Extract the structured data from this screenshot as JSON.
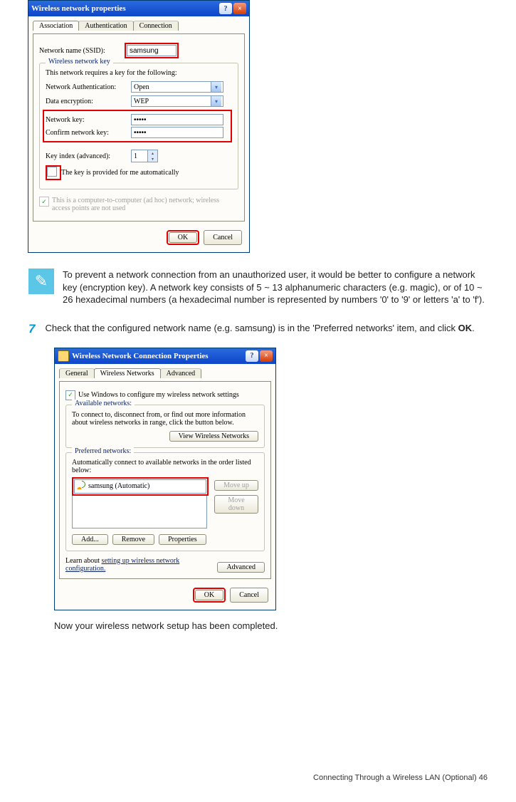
{
  "dialog1": {
    "title": "Wireless network properties",
    "tabs": [
      "Association",
      "Authentication",
      "Connection"
    ],
    "ssid_label": "Network name (SSID):",
    "ssid_value": "samsung",
    "group_legend": "Wireless network key",
    "group_intro": "This network requires a key for the following:",
    "auth_label": "Network Authentication:",
    "auth_value": "Open",
    "enc_label": "Data encryption:",
    "enc_value": "WEP",
    "key_label": "Network key:",
    "key_value": "•••••",
    "confirm_label": "Confirm network key:",
    "confirm_value": "•••••",
    "keyidx_label": "Key index (advanced):",
    "keyidx_value": "1",
    "auto_cb_label": "The key is provided for me automatically",
    "adhoc_cb_label": "This is a computer-to-computer (ad hoc) network; wireless access points are not used",
    "ok": "OK",
    "cancel": "Cancel"
  },
  "note": "To prevent a network connection from an unauthorized user, it would be better to configure a network key (encryption key). A network key consists of 5 ~ 13 alphanumeric characters (e.g. magic), or of 10 ~ 26 hexadecimal numbers (a hexadecimal number is represented by numbers '0' to '9' or letters 'a' to 'f').",
  "step": {
    "num": "7",
    "text_before": "Check that the configured network name (e.g. samsung) is in the 'Preferred networks' item, and click ",
    "bold": "OK",
    "text_after": "."
  },
  "dialog2": {
    "title": "Wireless Network Connection Properties",
    "tabs": [
      "General",
      "Wireless Networks",
      "Advanced"
    ],
    "use_cb_label": "Use Windows to configure my wireless network settings",
    "avail_legend": "Available networks:",
    "avail_text": "To connect to, disconnect from, or find out more information about wireless networks in range, click the button below.",
    "view_btn": "View Wireless Networks",
    "pref_legend": "Preferred networks:",
    "pref_text": "Automatically connect to available networks in the order listed below:",
    "pref_item": "samsung (Automatic)",
    "moveup": "Move up",
    "movedown": "Move down",
    "add": "Add...",
    "remove": "Remove",
    "props": "Properties",
    "learn": "Learn about ",
    "learn_link": "setting up wireless network configuration.",
    "adv": "Advanced",
    "ok": "OK",
    "cancel": "Cancel"
  },
  "after": "Now your wireless network setup has been completed.",
  "footer": "Connecting Through a Wireless LAN (Optional)   46"
}
